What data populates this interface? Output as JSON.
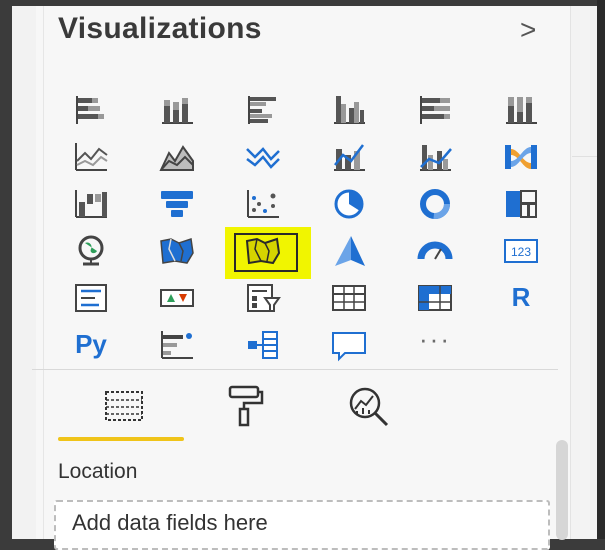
{
  "panel": {
    "title": "Visualizations",
    "expand_icon": "chevron-right-icon"
  },
  "visuals": [
    {
      "id": "stacked-bar-chart",
      "icon": "stacked-bar-chart-icon"
    },
    {
      "id": "stacked-column-chart",
      "icon": "stacked-column-chart-icon"
    },
    {
      "id": "clustered-bar-chart",
      "icon": "clustered-bar-chart-icon"
    },
    {
      "id": "clustered-column-chart",
      "icon": "clustered-column-chart-icon"
    },
    {
      "id": "100-stacked-bar-chart",
      "icon": "100-stacked-bar-chart-icon"
    },
    {
      "id": "100-stacked-column-chart",
      "icon": "100-stacked-column-chart-icon"
    },
    {
      "id": "line-chart",
      "icon": "line-chart-icon"
    },
    {
      "id": "area-chart",
      "icon": "area-chart-icon"
    },
    {
      "id": "stacked-area-chart",
      "icon": "stacked-area-chart-icon"
    },
    {
      "id": "line-and-stacked-column-chart",
      "icon": "line-and-stacked-column-chart-icon"
    },
    {
      "id": "line-and-clustered-column-chart",
      "icon": "line-and-clustered-column-chart-icon"
    },
    {
      "id": "ribbon-chart",
      "icon": "ribbon-chart-icon"
    },
    {
      "id": "waterfall-chart",
      "icon": "waterfall-chart-icon"
    },
    {
      "id": "funnel-chart",
      "icon": "funnel-chart-icon"
    },
    {
      "id": "scatter-chart",
      "icon": "scatter-chart-icon"
    },
    {
      "id": "pie-chart",
      "icon": "pie-chart-icon"
    },
    {
      "id": "donut-chart",
      "icon": "donut-chart-icon"
    },
    {
      "id": "treemap",
      "icon": "treemap-icon"
    },
    {
      "id": "map",
      "icon": "globe-map-icon"
    },
    {
      "id": "filled-map",
      "icon": "filled-map-icon"
    },
    {
      "id": "shape-map",
      "icon": "shape-map-icon",
      "selected": true,
      "highlight_color": "#f1f500"
    },
    {
      "id": "azure-map",
      "icon": "azure-map-icon"
    },
    {
      "id": "gauge",
      "icon": "gauge-icon"
    },
    {
      "id": "card",
      "icon": "card-icon",
      "text": "123"
    },
    {
      "id": "multi-row-card",
      "icon": "multi-row-card-icon"
    },
    {
      "id": "kpi",
      "icon": "kpi-icon"
    },
    {
      "id": "slicer",
      "icon": "slicer-icon"
    },
    {
      "id": "table",
      "icon": "table-icon"
    },
    {
      "id": "matrix",
      "icon": "matrix-icon"
    },
    {
      "id": "r-visual",
      "icon": "r-script-icon",
      "text": "R"
    },
    {
      "id": "python-visual",
      "icon": "python-icon",
      "text": "Py"
    },
    {
      "id": "key-influencers",
      "icon": "key-influencers-icon"
    },
    {
      "id": "decomposition-tree",
      "icon": "decomposition-tree-icon"
    },
    {
      "id": "qa",
      "icon": "speech-bubble-icon"
    },
    {
      "id": "more-visuals",
      "icon": "ellipsis-icon",
      "text": "···"
    }
  ],
  "subtabs": [
    {
      "id": "fields",
      "icon": "fields-icon",
      "active": true
    },
    {
      "id": "format",
      "icon": "paint-roller-icon"
    },
    {
      "id": "analytics",
      "icon": "analytics-magnifier-icon"
    }
  ],
  "wells": {
    "location_label": "Location",
    "drop_placeholder": "Add data fields here"
  },
  "colors": {
    "accent_underline": "#f0c419",
    "blue": "#1f6fd1",
    "highlight": "#f1f500"
  }
}
